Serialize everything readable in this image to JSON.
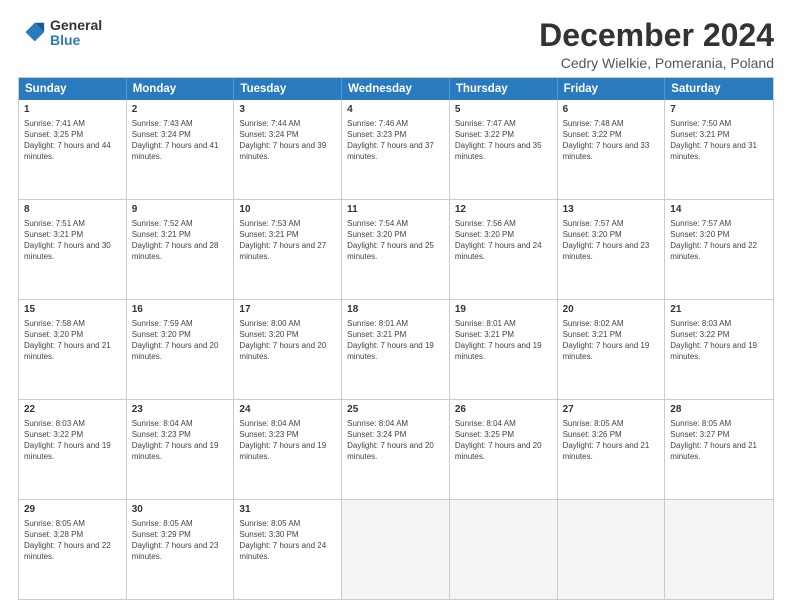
{
  "logo": {
    "general": "General",
    "blue": "Blue"
  },
  "title": "December 2024",
  "subtitle": "Cedry Wielkie, Pomerania, Poland",
  "days": [
    "Sunday",
    "Monday",
    "Tuesday",
    "Wednesday",
    "Thursday",
    "Friday",
    "Saturday"
  ],
  "weeks": [
    [
      {
        "day": "1",
        "sunrise": "Sunrise: 7:41 AM",
        "sunset": "Sunset: 3:25 PM",
        "daylight": "Daylight: 7 hours and 44 minutes."
      },
      {
        "day": "2",
        "sunrise": "Sunrise: 7:43 AM",
        "sunset": "Sunset: 3:24 PM",
        "daylight": "Daylight: 7 hours and 41 minutes."
      },
      {
        "day": "3",
        "sunrise": "Sunrise: 7:44 AM",
        "sunset": "Sunset: 3:24 PM",
        "daylight": "Daylight: 7 hours and 39 minutes."
      },
      {
        "day": "4",
        "sunrise": "Sunrise: 7:46 AM",
        "sunset": "Sunset: 3:23 PM",
        "daylight": "Daylight: 7 hours and 37 minutes."
      },
      {
        "day": "5",
        "sunrise": "Sunrise: 7:47 AM",
        "sunset": "Sunset: 3:22 PM",
        "daylight": "Daylight: 7 hours and 35 minutes."
      },
      {
        "day": "6",
        "sunrise": "Sunrise: 7:48 AM",
        "sunset": "Sunset: 3:22 PM",
        "daylight": "Daylight: 7 hours and 33 minutes."
      },
      {
        "day": "7",
        "sunrise": "Sunrise: 7:50 AM",
        "sunset": "Sunset: 3:21 PM",
        "daylight": "Daylight: 7 hours and 31 minutes."
      }
    ],
    [
      {
        "day": "8",
        "sunrise": "Sunrise: 7:51 AM",
        "sunset": "Sunset: 3:21 PM",
        "daylight": "Daylight: 7 hours and 30 minutes."
      },
      {
        "day": "9",
        "sunrise": "Sunrise: 7:52 AM",
        "sunset": "Sunset: 3:21 PM",
        "daylight": "Daylight: 7 hours and 28 minutes."
      },
      {
        "day": "10",
        "sunrise": "Sunrise: 7:53 AM",
        "sunset": "Sunset: 3:21 PM",
        "daylight": "Daylight: 7 hours and 27 minutes."
      },
      {
        "day": "11",
        "sunrise": "Sunrise: 7:54 AM",
        "sunset": "Sunset: 3:20 PM",
        "daylight": "Daylight: 7 hours and 25 minutes."
      },
      {
        "day": "12",
        "sunrise": "Sunrise: 7:56 AM",
        "sunset": "Sunset: 3:20 PM",
        "daylight": "Daylight: 7 hours and 24 minutes."
      },
      {
        "day": "13",
        "sunrise": "Sunrise: 7:57 AM",
        "sunset": "Sunset: 3:20 PM",
        "daylight": "Daylight: 7 hours and 23 minutes."
      },
      {
        "day": "14",
        "sunrise": "Sunrise: 7:57 AM",
        "sunset": "Sunset: 3:20 PM",
        "daylight": "Daylight: 7 hours and 22 minutes."
      }
    ],
    [
      {
        "day": "15",
        "sunrise": "Sunrise: 7:58 AM",
        "sunset": "Sunset: 3:20 PM",
        "daylight": "Daylight: 7 hours and 21 minutes."
      },
      {
        "day": "16",
        "sunrise": "Sunrise: 7:59 AM",
        "sunset": "Sunset: 3:20 PM",
        "daylight": "Daylight: 7 hours and 20 minutes."
      },
      {
        "day": "17",
        "sunrise": "Sunrise: 8:00 AM",
        "sunset": "Sunset: 3:20 PM",
        "daylight": "Daylight: 7 hours and 20 minutes."
      },
      {
        "day": "18",
        "sunrise": "Sunrise: 8:01 AM",
        "sunset": "Sunset: 3:21 PM",
        "daylight": "Daylight: 7 hours and 19 minutes."
      },
      {
        "day": "19",
        "sunrise": "Sunrise: 8:01 AM",
        "sunset": "Sunset: 3:21 PM",
        "daylight": "Daylight: 7 hours and 19 minutes."
      },
      {
        "day": "20",
        "sunrise": "Sunrise: 8:02 AM",
        "sunset": "Sunset: 3:21 PM",
        "daylight": "Daylight: 7 hours and 19 minutes."
      },
      {
        "day": "21",
        "sunrise": "Sunrise: 8:03 AM",
        "sunset": "Sunset: 3:22 PM",
        "daylight": "Daylight: 7 hours and 19 minutes."
      }
    ],
    [
      {
        "day": "22",
        "sunrise": "Sunrise: 8:03 AM",
        "sunset": "Sunset: 3:22 PM",
        "daylight": "Daylight: 7 hours and 19 minutes."
      },
      {
        "day": "23",
        "sunrise": "Sunrise: 8:04 AM",
        "sunset": "Sunset: 3:23 PM",
        "daylight": "Daylight: 7 hours and 19 minutes."
      },
      {
        "day": "24",
        "sunrise": "Sunrise: 8:04 AM",
        "sunset": "Sunset: 3:23 PM",
        "daylight": "Daylight: 7 hours and 19 minutes."
      },
      {
        "day": "25",
        "sunrise": "Sunrise: 8:04 AM",
        "sunset": "Sunset: 3:24 PM",
        "daylight": "Daylight: 7 hours and 20 minutes."
      },
      {
        "day": "26",
        "sunrise": "Sunrise: 8:04 AM",
        "sunset": "Sunset: 3:25 PM",
        "daylight": "Daylight: 7 hours and 20 minutes."
      },
      {
        "day": "27",
        "sunrise": "Sunrise: 8:05 AM",
        "sunset": "Sunset: 3:26 PM",
        "daylight": "Daylight: 7 hours and 21 minutes."
      },
      {
        "day": "28",
        "sunrise": "Sunrise: 8:05 AM",
        "sunset": "Sunset: 3:27 PM",
        "daylight": "Daylight: 7 hours and 21 minutes."
      }
    ],
    [
      {
        "day": "29",
        "sunrise": "Sunrise: 8:05 AM",
        "sunset": "Sunset: 3:28 PM",
        "daylight": "Daylight: 7 hours and 22 minutes."
      },
      {
        "day": "30",
        "sunrise": "Sunrise: 8:05 AM",
        "sunset": "Sunset: 3:29 PM",
        "daylight": "Daylight: 7 hours and 23 minutes."
      },
      {
        "day": "31",
        "sunrise": "Sunrise: 8:05 AM",
        "sunset": "Sunset: 3:30 PM",
        "daylight": "Daylight: 7 hours and 24 minutes."
      },
      null,
      null,
      null,
      null
    ]
  ]
}
